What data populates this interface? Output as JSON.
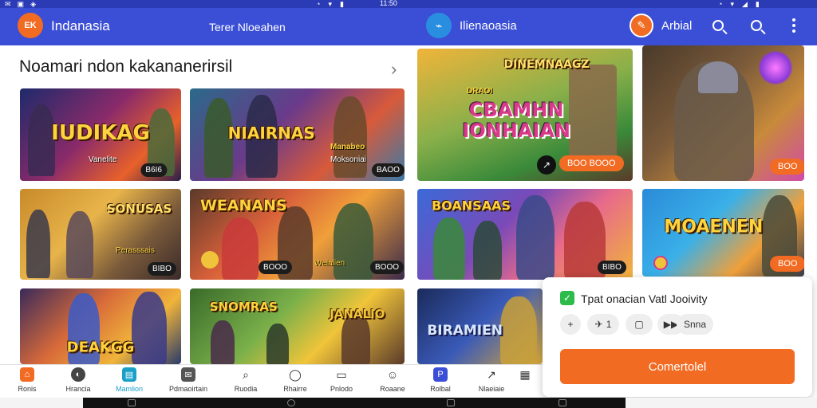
{
  "status_bar": {
    "time": "11:50"
  },
  "app_bar": {
    "logo_text": "EK",
    "app_name": "Indanasia",
    "center_title": "Terer Nloeahen",
    "app_name_2": "Ilienaoasia",
    "right_label": "Arbial"
  },
  "section": {
    "title": "Noamari ndon kakananerirsil"
  },
  "cards": [
    {
      "title": "IUDIKAG",
      "subtitle": "Vanelite",
      "badge": "B6I6"
    },
    {
      "title": "NIAIRNAS",
      "subtitle": "Moksoniai",
      "badge": "BAOO",
      "tag": "Manabeo"
    },
    {
      "title": "CBAMHN IONHAIAN",
      "top_title": "DINEMNAAGZ",
      "subtitle": "DRAOI",
      "badge": "BOO BOOO"
    },
    {
      "title": "",
      "badge": "BOO"
    },
    {
      "title": "SONUSAS",
      "subtitle": "Perasssais",
      "badge": "BIBO"
    },
    {
      "title": "WEANANS",
      "subtitle": "Weialien",
      "badge": "BOOO"
    },
    {
      "title": "BOANSAAS",
      "subtitle": "",
      "badge": "BIBO"
    },
    {
      "title": "MOAENEN",
      "subtitle": "",
      "badge": "BOO"
    },
    {
      "title": "DEAKGG",
      "subtitle": "",
      "badge": ""
    },
    {
      "title": "SNOMRAS",
      "subtitle": "JANALIO",
      "badge": ""
    },
    {
      "title": "BIRAMIEN",
      "subtitle": "",
      "badge": ""
    }
  ],
  "bottom_nav": [
    {
      "label": "Ronis",
      "icon": "home-icon",
      "color": "#f26b23"
    },
    {
      "label": "Hrancia",
      "icon": "chat-icon",
      "color": "#444444"
    },
    {
      "label": "Mamlion",
      "icon": "store-icon",
      "color": "#1aa0c8"
    },
    {
      "label": "Pdmaoirtain",
      "icon": "mail-icon",
      "color": "#555555"
    },
    {
      "label": "Ruodia",
      "icon": "search-icon",
      "color": "#555555"
    },
    {
      "label": "Rhairre",
      "icon": "bubble-icon",
      "color": "#555555"
    },
    {
      "label": "Pnlodo",
      "icon": "doc-icon",
      "color": "#555555"
    },
    {
      "label": "Roaane",
      "icon": "user-icon",
      "color": "#555555"
    },
    {
      "label": "Rolbal",
      "icon": "profile-icon",
      "color": "#3b4fd6"
    },
    {
      "label": "Nlaeiaie",
      "icon": "share-icon",
      "color": "#555555"
    }
  ],
  "popup": {
    "title": "Tpat onacian Vatl Jooivity",
    "chips": [
      {
        "icon": "plus-icon",
        "label": "+"
      },
      {
        "icon": "plane-icon",
        "label": "1"
      },
      {
        "icon": "square-icon",
        "label": ""
      },
      {
        "icon": "forward-icon",
        "label": ""
      },
      {
        "icon": "dollar-icon",
        "label": "Snna"
      }
    ],
    "cta_label": "Comertolel"
  },
  "colors": {
    "primary": "#3b4fd6",
    "accent": "#f26b23",
    "success": "#2dbb4a"
  }
}
